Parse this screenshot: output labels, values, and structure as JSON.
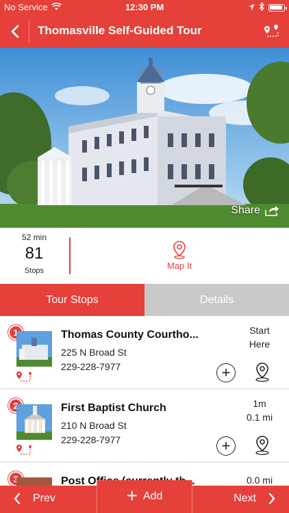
{
  "status": {
    "carrier": "No Service",
    "time": "12:30 PM"
  },
  "header": {
    "title": "Thomasville Self-Guided Tour"
  },
  "hero": {
    "share_label": "Share"
  },
  "stats": {
    "duration": "52 min",
    "stop_count": "81",
    "stops_label": "Stops",
    "map_label": "Map It"
  },
  "tabs": [
    {
      "label": "Tour Stops",
      "active": true
    },
    {
      "label": "Details",
      "active": false
    }
  ],
  "stops": [
    {
      "number": "1",
      "name": "Thomas County Courtho...",
      "address": "225 N Broad St",
      "phone": "229-228-7977",
      "meta_line1": "Start",
      "meta_line2": "Here"
    },
    {
      "number": "2",
      "name": "First Baptist Church",
      "address": "210 N Broad St",
      "phone": "229-228-7977",
      "meta_line1": "1m",
      "meta_line2": "0.1 mi"
    },
    {
      "number": "3",
      "name": "Post Office (currently th...",
      "address": "",
      "phone": "",
      "meta_line1": "0.0 mi",
      "meta_line2": ""
    }
  ],
  "bottom": {
    "prev_label": "Prev",
    "add_label": "Add",
    "next_label": "Next"
  },
  "colors": {
    "accent": "#e5403a",
    "inactive_tab": "#c9c9c9"
  }
}
